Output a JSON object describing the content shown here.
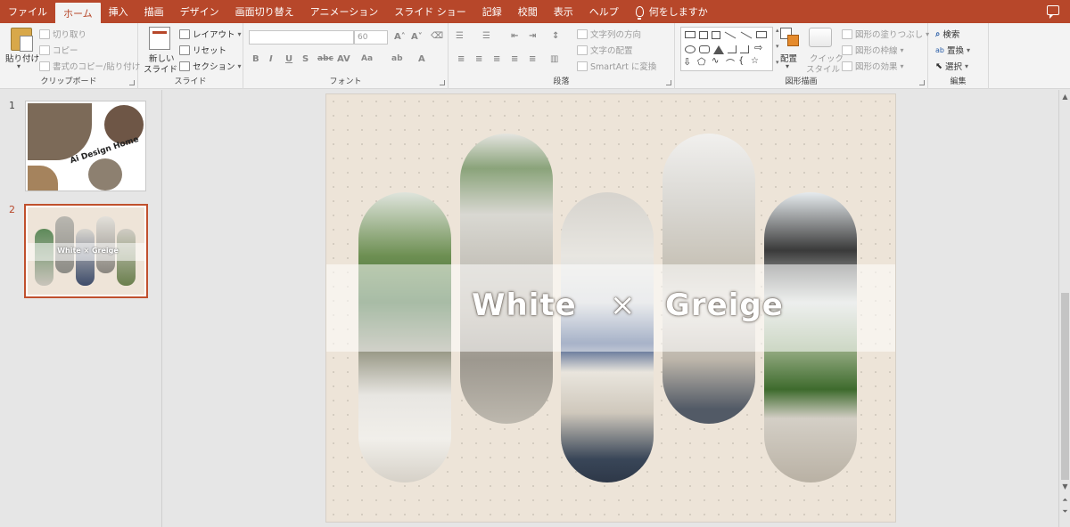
{
  "tabs": [
    {
      "label": "ファイル"
    },
    {
      "label": "ホーム"
    },
    {
      "label": "挿入"
    },
    {
      "label": "描画"
    },
    {
      "label": "デザイン"
    },
    {
      "label": "画面切り替え"
    },
    {
      "label": "アニメーション"
    },
    {
      "label": "スライド ショー"
    },
    {
      "label": "記録"
    },
    {
      "label": "校閲"
    },
    {
      "label": "表示"
    },
    {
      "label": "ヘルプ"
    }
  ],
  "tell_me": "何をしますか",
  "ribbon": {
    "clipboard": {
      "paste": "貼り付け",
      "cut": "切り取り",
      "copy": "コピー",
      "format_painter": "書式のコピー/貼り付け",
      "label": "クリップボード"
    },
    "slides": {
      "new_slide_line1": "新しい",
      "new_slide_line2": "スライド",
      "layout": "レイアウト",
      "reset": "リセット",
      "section": "セクション",
      "label": "スライド"
    },
    "font": {
      "size": "60",
      "label": "フォント"
    },
    "paragraph": {
      "text_direction": "文字列の方向",
      "align_text": "文字の配置",
      "smartart": "SmartArt に変換",
      "label": "段落"
    },
    "drawing": {
      "arrange": "配置",
      "quick_style_line1": "クイック",
      "quick_style_line2": "スタイル",
      "shape_fill": "図形の塗りつぶし",
      "shape_outline": "図形の枠線",
      "shape_effects": "図形の効果",
      "label": "図形描画"
    },
    "editing": {
      "find": "検索",
      "replace": "置換",
      "select": "選択",
      "label": "編集"
    }
  },
  "thumbnails": [
    {
      "number": "1",
      "title": "Ai Design Home"
    },
    {
      "number": "2",
      "title": "White × Greige"
    }
  ],
  "slide": {
    "word_left": "White",
    "symbol": "×",
    "word_right": "Greige"
  },
  "colors": {
    "accent": "#b7472a",
    "slide_bg": "#ede4d8",
    "selected_border": "#c0502d"
  }
}
